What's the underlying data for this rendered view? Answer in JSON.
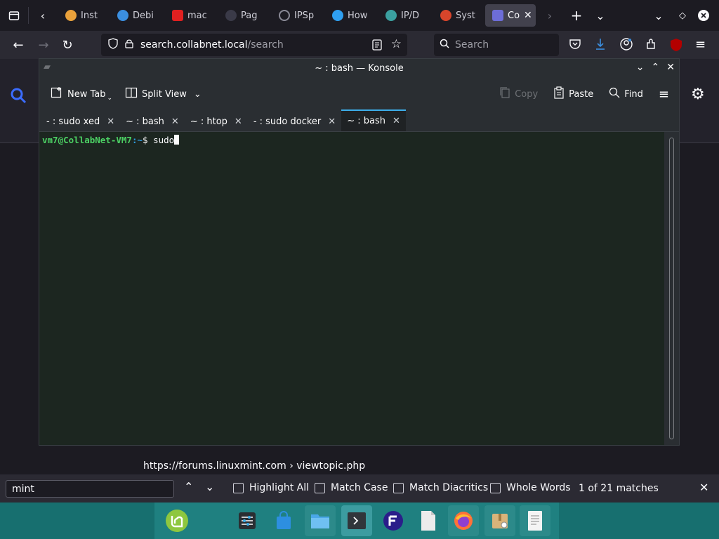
{
  "browser": {
    "tabs": [
      {
        "label": "Inst",
        "color": "#e9a13b"
      },
      {
        "label": "Debi",
        "color": "#3b8fe0"
      },
      {
        "label": "mac",
        "color": "#e02020"
      },
      {
        "label": "Pag",
        "color": "#3a3a48"
      },
      {
        "label": "IPSp",
        "color": "#8a8a96"
      },
      {
        "label": "How",
        "color": "#2f9ff0"
      },
      {
        "label": "IP/D",
        "color": "#3ba0a0"
      },
      {
        "label": "Syst",
        "color": "#d8452b"
      },
      {
        "label": "Co",
        "color": "#6d6dd8"
      }
    ],
    "url_host": "search.collabnet.local",
    "url_path": "/search",
    "search_placeholder": "Search",
    "link_preview": "https://forums.linuxmint.com  › viewtopic.php"
  },
  "konsole": {
    "title": "~ : bash — Konsole",
    "toolbar": {
      "new_tab": "New Tab",
      "split_view": "Split View",
      "copy": "Copy",
      "paste": "Paste",
      "find": "Find"
    },
    "tabs": [
      {
        "label": "- : sudo xed"
      },
      {
        "label": "~ : bash"
      },
      {
        "label": "~ : htop"
      },
      {
        "label": "- : sudo docker"
      },
      {
        "label": "~ : bash"
      }
    ],
    "prompt_user": "vm7@CollabNet-VM7",
    "prompt_path": ":~",
    "prompt_sign": "$",
    "command": "sudo"
  },
  "findbar": {
    "query": "mint",
    "highlight_all": "Highlight All",
    "match_case": "Match Case",
    "match_diacritics": "Match Diacritics",
    "whole_words": "Whole Words",
    "matches": "1 of 21 matches"
  },
  "colors": {
    "accent": "#3daee9",
    "taskbar": "#176f6f",
    "prompt_green": "#4cd164"
  }
}
